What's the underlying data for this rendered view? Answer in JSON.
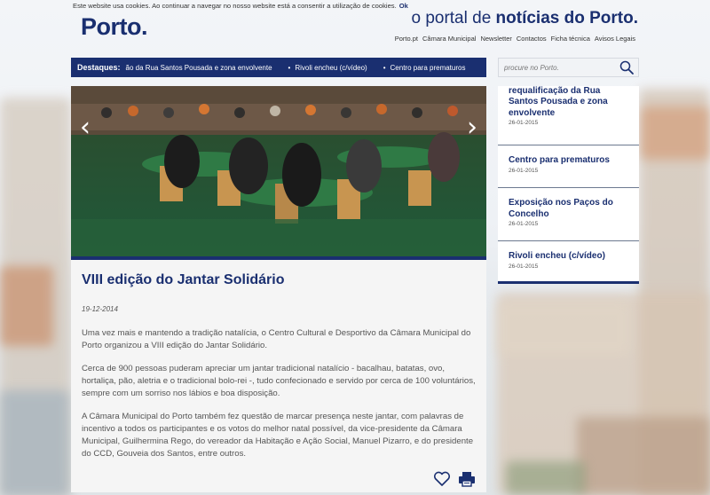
{
  "cookie": {
    "text": "Este website usa cookies. Ao continuar a navegar no nosso website está a consentir a utilização de cookies.",
    "ok": "Ok"
  },
  "header": {
    "logo": "Porto.",
    "tagline_pre": "o portal de ",
    "tagline_bold": "notícias do Porto.",
    "links": [
      "Porto.pt",
      "Câmara Municipal",
      "Newsletter",
      "Contactos",
      "Ficha técnica",
      "Avisos Legais"
    ]
  },
  "highlights": {
    "label": "Destaques:",
    "items": [
      "ão da Rua Santos Pousada e zona envolvente",
      "Rivoli encheu (c/vídeo)",
      "Centro para prematuros"
    ]
  },
  "search": {
    "placeholder": "procure no Porto."
  },
  "slider": {
    "prev": "‹",
    "next": "›"
  },
  "article": {
    "title": "VIII edição do Jantar Solidário",
    "date": "19-12-2014",
    "paragraphs": [
      "Uma vez mais e mantendo a tradição natalícia, o Centro Cultural e Desportivo da Câmara Municipal do Porto organizou a VIII edição do Jantar Solidário.",
      "Cerca de 900 pessoas puderam apreciar um jantar tradicional natalício - bacalhau, batatas, ovo, hortaliça, pão, aletria e o tradicional bolo-rei -, tudo confecionado e servido por cerca de 100 voluntários, sempre com um sorriso nos lábios e boa disposição.",
      "A Câmara Municipal do Porto também fez questão de marcar presença neste jantar, com palavras de incentivo a todos os participantes e os votos do melhor natal possível, da vice-presidente da Câmara Municipal, Guilhermina Rego, do vereador da Habitação e Ação Social, Manuel Pizarro, e do presidente do CCD, Gouveia dos Santos, entre outros."
    ]
  },
  "sidebar": {
    "items": [
      {
        "title": "apresentam projeto de requalificação da Rua Santos Pousada e zona envolvente",
        "date": "26-01-2015"
      },
      {
        "title": "Centro para prematuros",
        "date": "26-01-2015"
      },
      {
        "title": "Exposição nos Paços do Concelho",
        "date": "26-01-2015"
      },
      {
        "title": "Rivoli encheu (c/vídeo)",
        "date": "26-01-2015"
      }
    ]
  },
  "colors": {
    "brand": "#1a2f70",
    "text": "#555555"
  },
  "icons": {
    "search": "search-icon",
    "favorite": "heart-icon",
    "print": "print-icon"
  }
}
